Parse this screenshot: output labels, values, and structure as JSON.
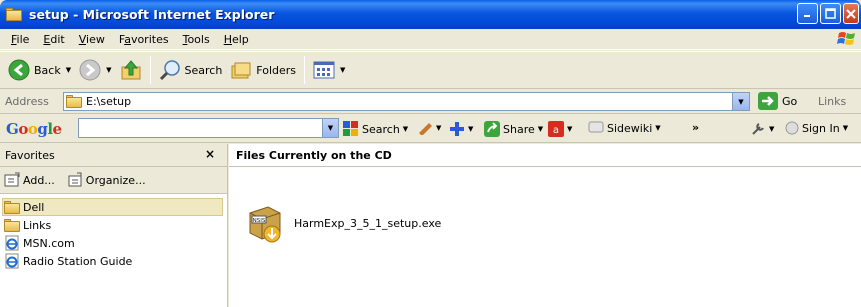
{
  "window": {
    "title": "setup - Microsoft Internet Explorer"
  },
  "menu": {
    "items": [
      "File",
      "Edit",
      "View",
      "Favorites",
      "Tools",
      "Help"
    ],
    "accelerators": [
      "F",
      "E",
      "V",
      "a",
      "T",
      "H"
    ]
  },
  "toolbar": {
    "back_label": "Back",
    "search_label": "Search",
    "folders_label": "Folders"
  },
  "address": {
    "label": "Address",
    "value": "E:\\setup",
    "go_label": "Go",
    "links_label": "Links"
  },
  "google": {
    "logo": "Google",
    "search_label": "Search",
    "share_label": "Share",
    "sidewiki_label": "Sidewiki",
    "overflow": "»",
    "signin_label": "Sign In"
  },
  "favorites": {
    "title": "Favorites",
    "close": "×",
    "add_label": "Add...",
    "organize_label": "Organize...",
    "items": [
      {
        "label": "Dell",
        "icon": "folder-icon",
        "selected": true
      },
      {
        "label": "Links",
        "icon": "folder-icon",
        "selected": false
      },
      {
        "label": "MSN.com",
        "icon": "ie-page-icon",
        "selected": false
      },
      {
        "label": "Radio Station Guide",
        "icon": "ie-page-icon",
        "selected": false
      }
    ]
  },
  "content": {
    "heading": "Files Currently on the CD",
    "files": [
      {
        "name": "HarmExp_3_5_1_setup.exe",
        "icon": "nsis-installer-icon"
      }
    ]
  },
  "colors": {
    "titlebar": "#0856df",
    "chrome": "#ece9d8",
    "close": "#c73816"
  }
}
